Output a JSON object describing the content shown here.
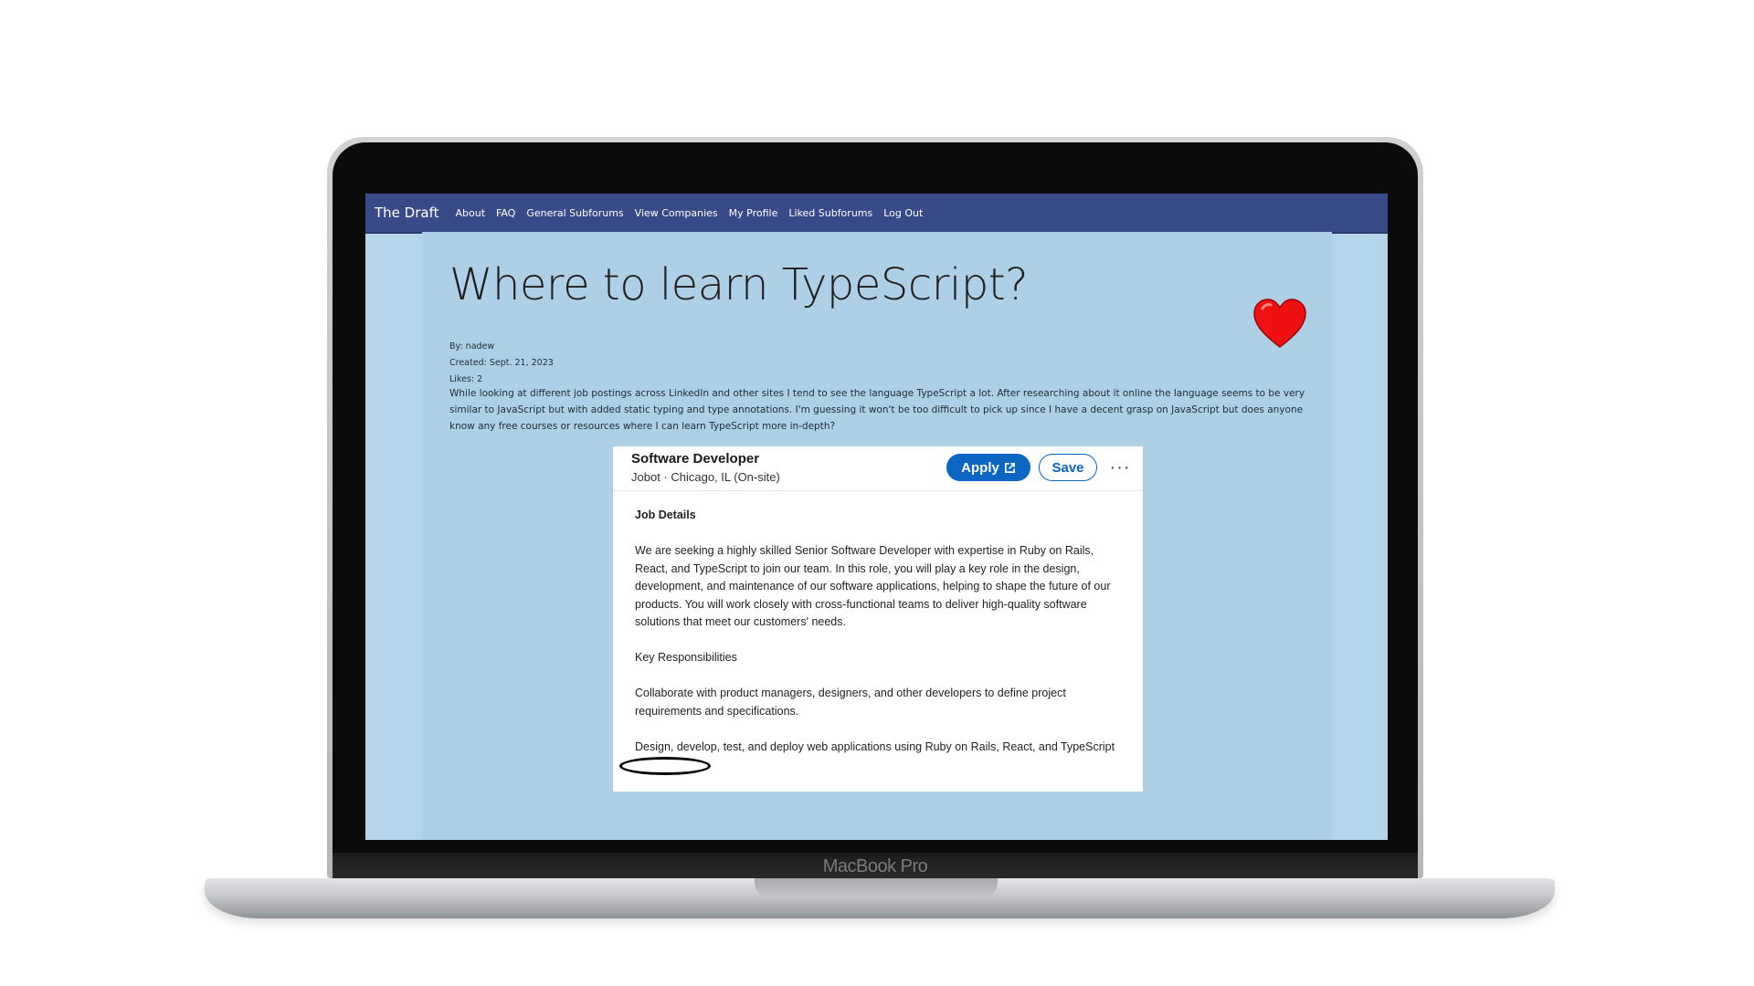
{
  "device": {
    "brand_label": "MacBook Pro"
  },
  "nav": {
    "brand": "The Draft",
    "links": [
      "About",
      "FAQ",
      "General Subforums",
      "View Companies",
      "My Profile",
      "Liked Subforums",
      "Log Out"
    ]
  },
  "post": {
    "title": "Where to learn TypeScript?",
    "by": "By: nadew",
    "created": "Created: Sept. 21, 2023",
    "likes": "Likes: 2",
    "body": "While looking at different job postings across LinkedIn and other sites I tend to see the language TypeScript a lot. After researching about it online the language seems to be very similar to JavaScript but with added static typing and type annotations. I'm guessing it won't be too difficult to pick up since I have a decent grasp on JavaScript but does anyone know any free courses or resources where I can learn TypeScript more in-depth?",
    "heart_color": "#ee1111"
  },
  "job": {
    "title": "Software Developer",
    "subtitle": "Jobot · Chicago, IL (On-site)",
    "apply_label": "Apply",
    "save_label": "Save",
    "more_label": "···",
    "section_heading": "Job Details",
    "description": "We are seeking a highly skilled Senior Software Developer with expertise in Ruby on Rails, React, and TypeScript to join our team. In this role, you will play a key role in the design, development, and maintenance of our software applications, helping to shape the future of our products. You will work closely with cross-functional teams to deliver high-quality software solutions that meet our customers' needs.",
    "responsibilities_heading": "Key Responsibilities",
    "responsibility_1": "Collaborate with product managers, designers, and other developers to define project requirements and specifications.",
    "responsibility_2": "Design, develop, test, and deploy web applications using Ruby on Rails, React, and TypeScript",
    "accent_color": "#0a66c2"
  }
}
